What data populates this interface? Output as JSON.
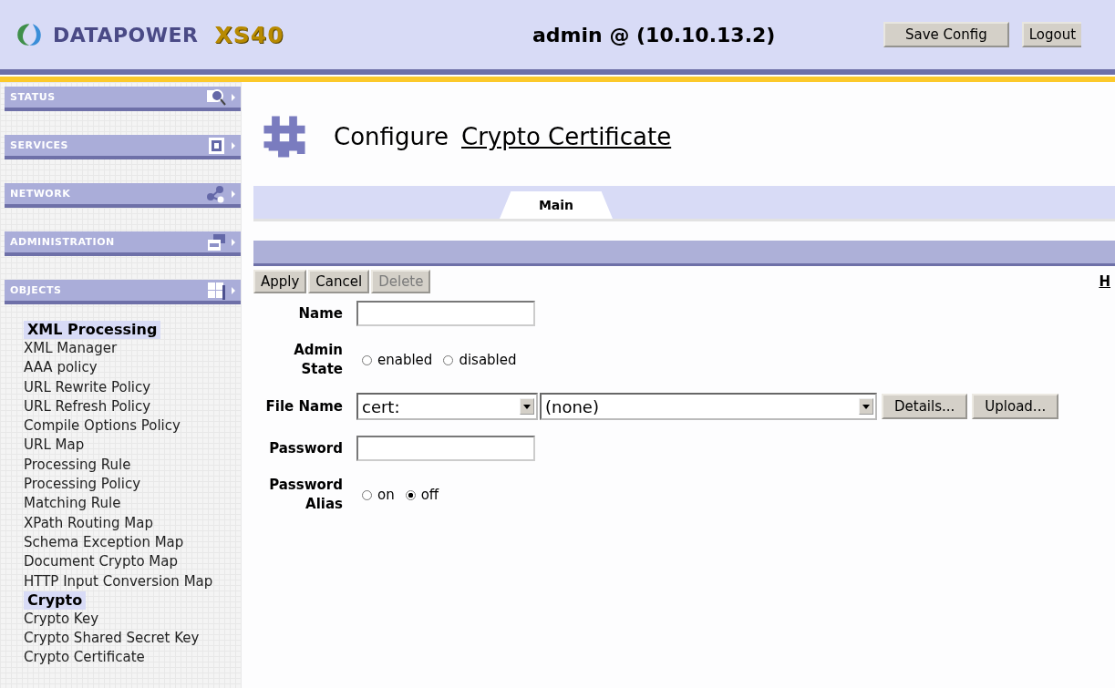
{
  "header": {
    "brand": "DATAPOWER",
    "model": "XS40",
    "user": "admin @ (10.10.13.2)",
    "buttons": [
      "Save Config",
      "Logout"
    ]
  },
  "nav": [
    {
      "label": "STATUS",
      "kind": "status"
    },
    {
      "label": "SERVICES",
      "kind": "services"
    },
    {
      "label": "NETWORK",
      "kind": "network"
    },
    {
      "label": "ADMINISTRATION",
      "kind": "administration"
    },
    {
      "label": "OBJECTS",
      "kind": "objects"
    }
  ],
  "objects": [
    {
      "heading": "XML Processing",
      "items": [
        "XML Manager",
        "AAA policy",
        "URL Rewrite Policy",
        "URL Refresh Policy",
        "Compile Options Policy",
        "URL Map",
        "Processing Rule",
        "Processing Policy",
        "Matching Rule",
        "XPath Routing Map",
        "Schema Exception Map",
        "Document Crypto Map",
        "HTTP Input Conversion Map"
      ]
    },
    {
      "heading": "Crypto",
      "items": [
        "Crypto Key",
        "Crypto Shared Secret Key",
        "Crypto Certificate"
      ]
    }
  ],
  "page": {
    "verb": "Configure",
    "object": "Crypto Certificate"
  },
  "tabs": [
    {
      "label": "Main",
      "selected": true
    }
  ],
  "actions": [
    {
      "label": "Apply",
      "disabled": false
    },
    {
      "label": "Cancel",
      "disabled": false
    },
    {
      "label": "Delete",
      "disabled": true
    }
  ],
  "help_link": "H",
  "form": [
    {
      "label": "Name",
      "kind": "text"
    },
    {
      "label": "Admin State",
      "kind": "radio",
      "options": [
        {
          "label": "enabled",
          "selected": false
        },
        {
          "label": "disabled",
          "selected": false
        }
      ]
    },
    {
      "label": "File Name",
      "kind": "file",
      "selects": [
        "cert:",
        "(none)"
      ],
      "buttons": [
        "Details...",
        "Upload..."
      ]
    },
    {
      "label": "Password",
      "kind": "text"
    },
    {
      "label": "Password Alias",
      "kind": "radio",
      "options": [
        {
          "label": "on",
          "selected": false
        },
        {
          "label": "off",
          "selected": true
        }
      ]
    }
  ]
}
